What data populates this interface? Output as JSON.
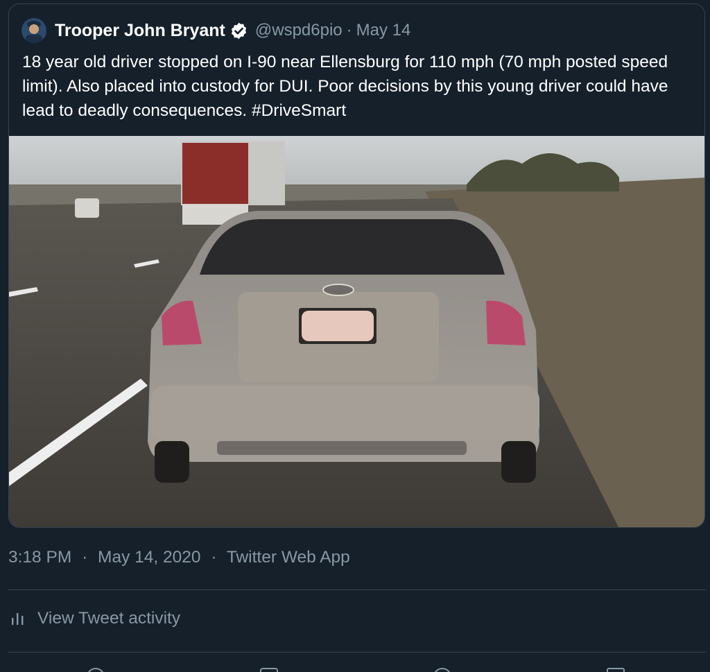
{
  "quoted_tweet": {
    "author_name": "Trooper John Bryant",
    "handle": "@wspd6pio",
    "separator": "·",
    "date": "May 14",
    "text": "18 year old driver stopped on I-90 near Ellensburg for 110 mph (70 mph posted speed limit).  Also placed into custody for DUI. Poor decisions by this young driver could have lead to deadly consequences. #DriveSmart"
  },
  "tweet_meta": {
    "time": "3:18 PM",
    "date": "May 14, 2020",
    "source": "Twitter Web App",
    "separator": "·"
  },
  "activity": {
    "label": "View Tweet activity"
  },
  "colors": {
    "background": "#15202b",
    "secondary_text": "#8899a6",
    "border": "#38444d",
    "primary_text": "#ffffff"
  },
  "icons": [
    "verified-badge-icon",
    "analytics-bar-icon",
    "reply-icon",
    "retweet-icon",
    "like-icon",
    "share-icon"
  ]
}
